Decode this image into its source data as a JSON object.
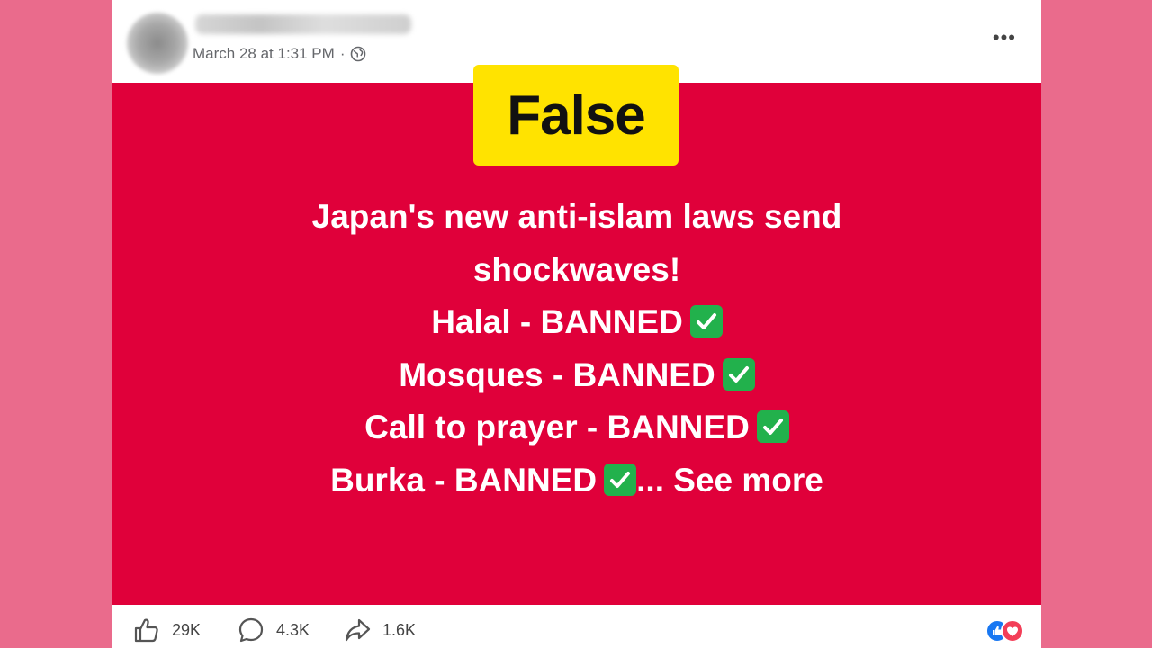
{
  "post": {
    "timestamp": "March 28 at 1:31 PM",
    "separator": "·",
    "verdict": "False",
    "lines": [
      "Japan's new anti-islam laws send",
      "shockwaves!",
      "Halal - BANNED",
      "Mosques - BANNED",
      "Call to prayer - BANNED",
      "Burka - BANNED"
    ],
    "see_more": "... See more"
  },
  "footer": {
    "likes": "29K",
    "comments": "4.3K",
    "shares": "1.6K"
  },
  "colors": {
    "page_bg": "#ea6b8c",
    "post_bg": "#e0003a",
    "verdict_bg": "#ffe300",
    "check": "#22b14c",
    "like_blue": "#1877f2",
    "love_red": "#f33e58"
  },
  "icons": [
    "globe-icon",
    "more-options-icon",
    "check-mark-icon",
    "like-icon",
    "comment-icon",
    "share-icon",
    "like-reaction-icon",
    "love-reaction-icon"
  ]
}
